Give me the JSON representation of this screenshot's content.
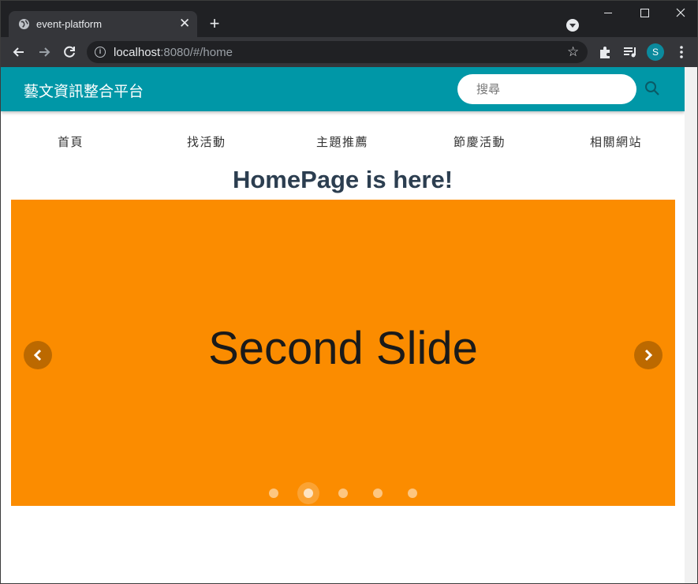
{
  "browser": {
    "tab_title": "event-platform",
    "tab_close": "✕",
    "new_tab": "+",
    "url_host": "localhost",
    "url_rest": ":8080/#/home",
    "avatar_letter": "S",
    "star": "☆"
  },
  "app": {
    "brand": "藝文資訊整合平台",
    "search_placeholder": "搜尋",
    "accent_color": "#0097a7",
    "nav": [
      "首頁",
      "找活動",
      "主題推薦",
      "節慶活動",
      "相關網站"
    ],
    "page_title": "HomePage is here!"
  },
  "carousel": {
    "slide_text": "Second Slide",
    "slide_color": "#fb8c00",
    "slide_count": 5,
    "active_index": 1
  },
  "icons": {
    "back": "arrow-left-icon",
    "forward": "arrow-right-icon",
    "reload": "reload-icon",
    "extensions": "puzzle-icon",
    "media": "playlist-icon",
    "menu": "kebab-menu-icon",
    "search": "search-icon"
  }
}
